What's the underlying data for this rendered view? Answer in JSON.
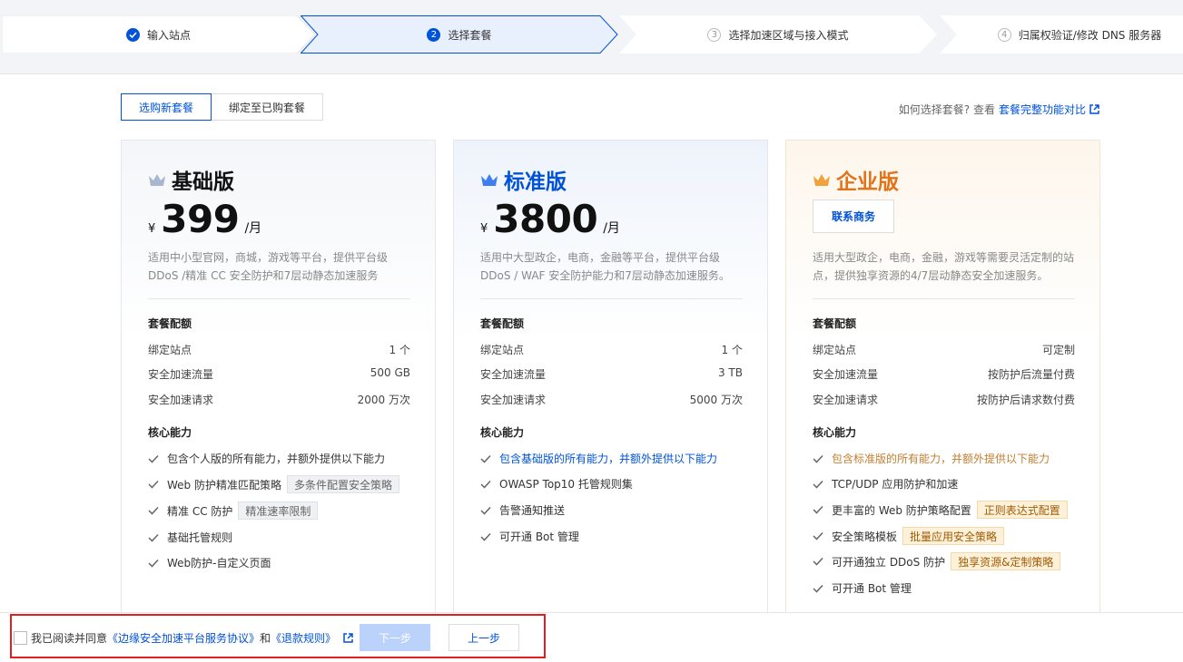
{
  "steps": [
    {
      "num": "",
      "label": "输入站点",
      "state": "done"
    },
    {
      "num": "2",
      "label": "选择套餐",
      "state": "active"
    },
    {
      "num": "3",
      "label": "选择加速区域与接入模式",
      "state": "todo"
    },
    {
      "num": "4",
      "label": "归属权验证/修改 DNS 服务器",
      "state": "todo"
    }
  ],
  "tabs": {
    "new": "选购新套餐",
    "bind": "绑定至已购套餐"
  },
  "compare": {
    "prefix": "如何选择套餐? 查看",
    "link": "套餐完整功能对比",
    "icon": "external-link-icon"
  },
  "plans": {
    "basic": {
      "name": "基础版",
      "currency": "¥",
      "price": "399",
      "unit": "/月",
      "desc": "适用中小型官网，商城，游戏等平台，提供平台级 DDoS /精准 CC 安全防护和7层动静态加速服务",
      "quota_title": "套餐配额",
      "quota": [
        {
          "k": "绑定站点",
          "v": "1 个"
        },
        {
          "k": "安全加速流量",
          "v": "500 GB"
        },
        {
          "k": "安全加速请求",
          "v": "2000 万次"
        }
      ],
      "core_title": "核心能力",
      "features": [
        {
          "text": "包含个人版的所有能力，并额外提供以下能力",
          "tag": ""
        },
        {
          "text": "Web 防护精准匹配策略",
          "tag": "多条件配置安全策略"
        },
        {
          "text": "精准 CC 防护",
          "tag": "精准速率限制"
        },
        {
          "text": "基础托管规则",
          "tag": ""
        },
        {
          "text": "Web防护-自定义页面",
          "tag": ""
        }
      ]
    },
    "standard": {
      "name": "标准版",
      "currency": "¥",
      "price": "3800",
      "unit": "/月",
      "desc": "适用中大型政企，电商，金融等平台，提供平台级 DDoS / WAF 安全防护能力和7层动静态加速服务。",
      "quota_title": "套餐配额",
      "quota": [
        {
          "k": "绑定站点",
          "v": "1 个"
        },
        {
          "k": "安全加速流量",
          "v": "3 TB"
        },
        {
          "k": "安全加速请求",
          "v": "5000 万次"
        }
      ],
      "core_title": "核心能力",
      "features": [
        {
          "text": "包含基础版的所有能力，并额外提供以下能力",
          "tag": ""
        },
        {
          "text": "OWASP Top10 托管规则集",
          "tag": ""
        },
        {
          "text": "告警通知推送",
          "tag": ""
        },
        {
          "text": "可开通 Bot 管理",
          "tag": ""
        }
      ]
    },
    "enterprise": {
      "name": "企业版",
      "contact": "联系商务",
      "desc": "适用大型政企，电商，金融，游戏等需要灵活定制的站点，提供独享资源的4/7层动静态安全加速服务。",
      "quota_title": "套餐配额",
      "quota": [
        {
          "k": "绑定站点",
          "v": "可定制"
        },
        {
          "k": "安全加速流量",
          "v": "按防护后流量付费"
        },
        {
          "k": "安全加速请求",
          "v": "按防护后请求数付费"
        }
      ],
      "core_title": "核心能力",
      "features": [
        {
          "text": "包含标准版的所有能力，并额外提供以下能力",
          "tag": ""
        },
        {
          "text": "TCP/UDP 应用防护和加速",
          "tag": ""
        },
        {
          "text": "更丰富的 Web 防护策略配置",
          "tag": "正则表达式配置"
        },
        {
          "text": "安全策略模板",
          "tag": "批量应用安全策略"
        },
        {
          "text": "可开通独立 DDoS 防护",
          "tag": "独享资源&定制策略"
        },
        {
          "text": "可开通 Bot 管理",
          "tag": ""
        }
      ]
    }
  },
  "footer": {
    "agree_prefix": "我已阅读并同意",
    "link1": "《边缘安全加速平台服务协议》",
    "and": "和",
    "link2": "《退款规则》",
    "next": "下一步",
    "prev": "上一步"
  },
  "colors": {
    "primary": "#0052d9",
    "orange": "#e37318",
    "highlight_box": "#e02020"
  }
}
